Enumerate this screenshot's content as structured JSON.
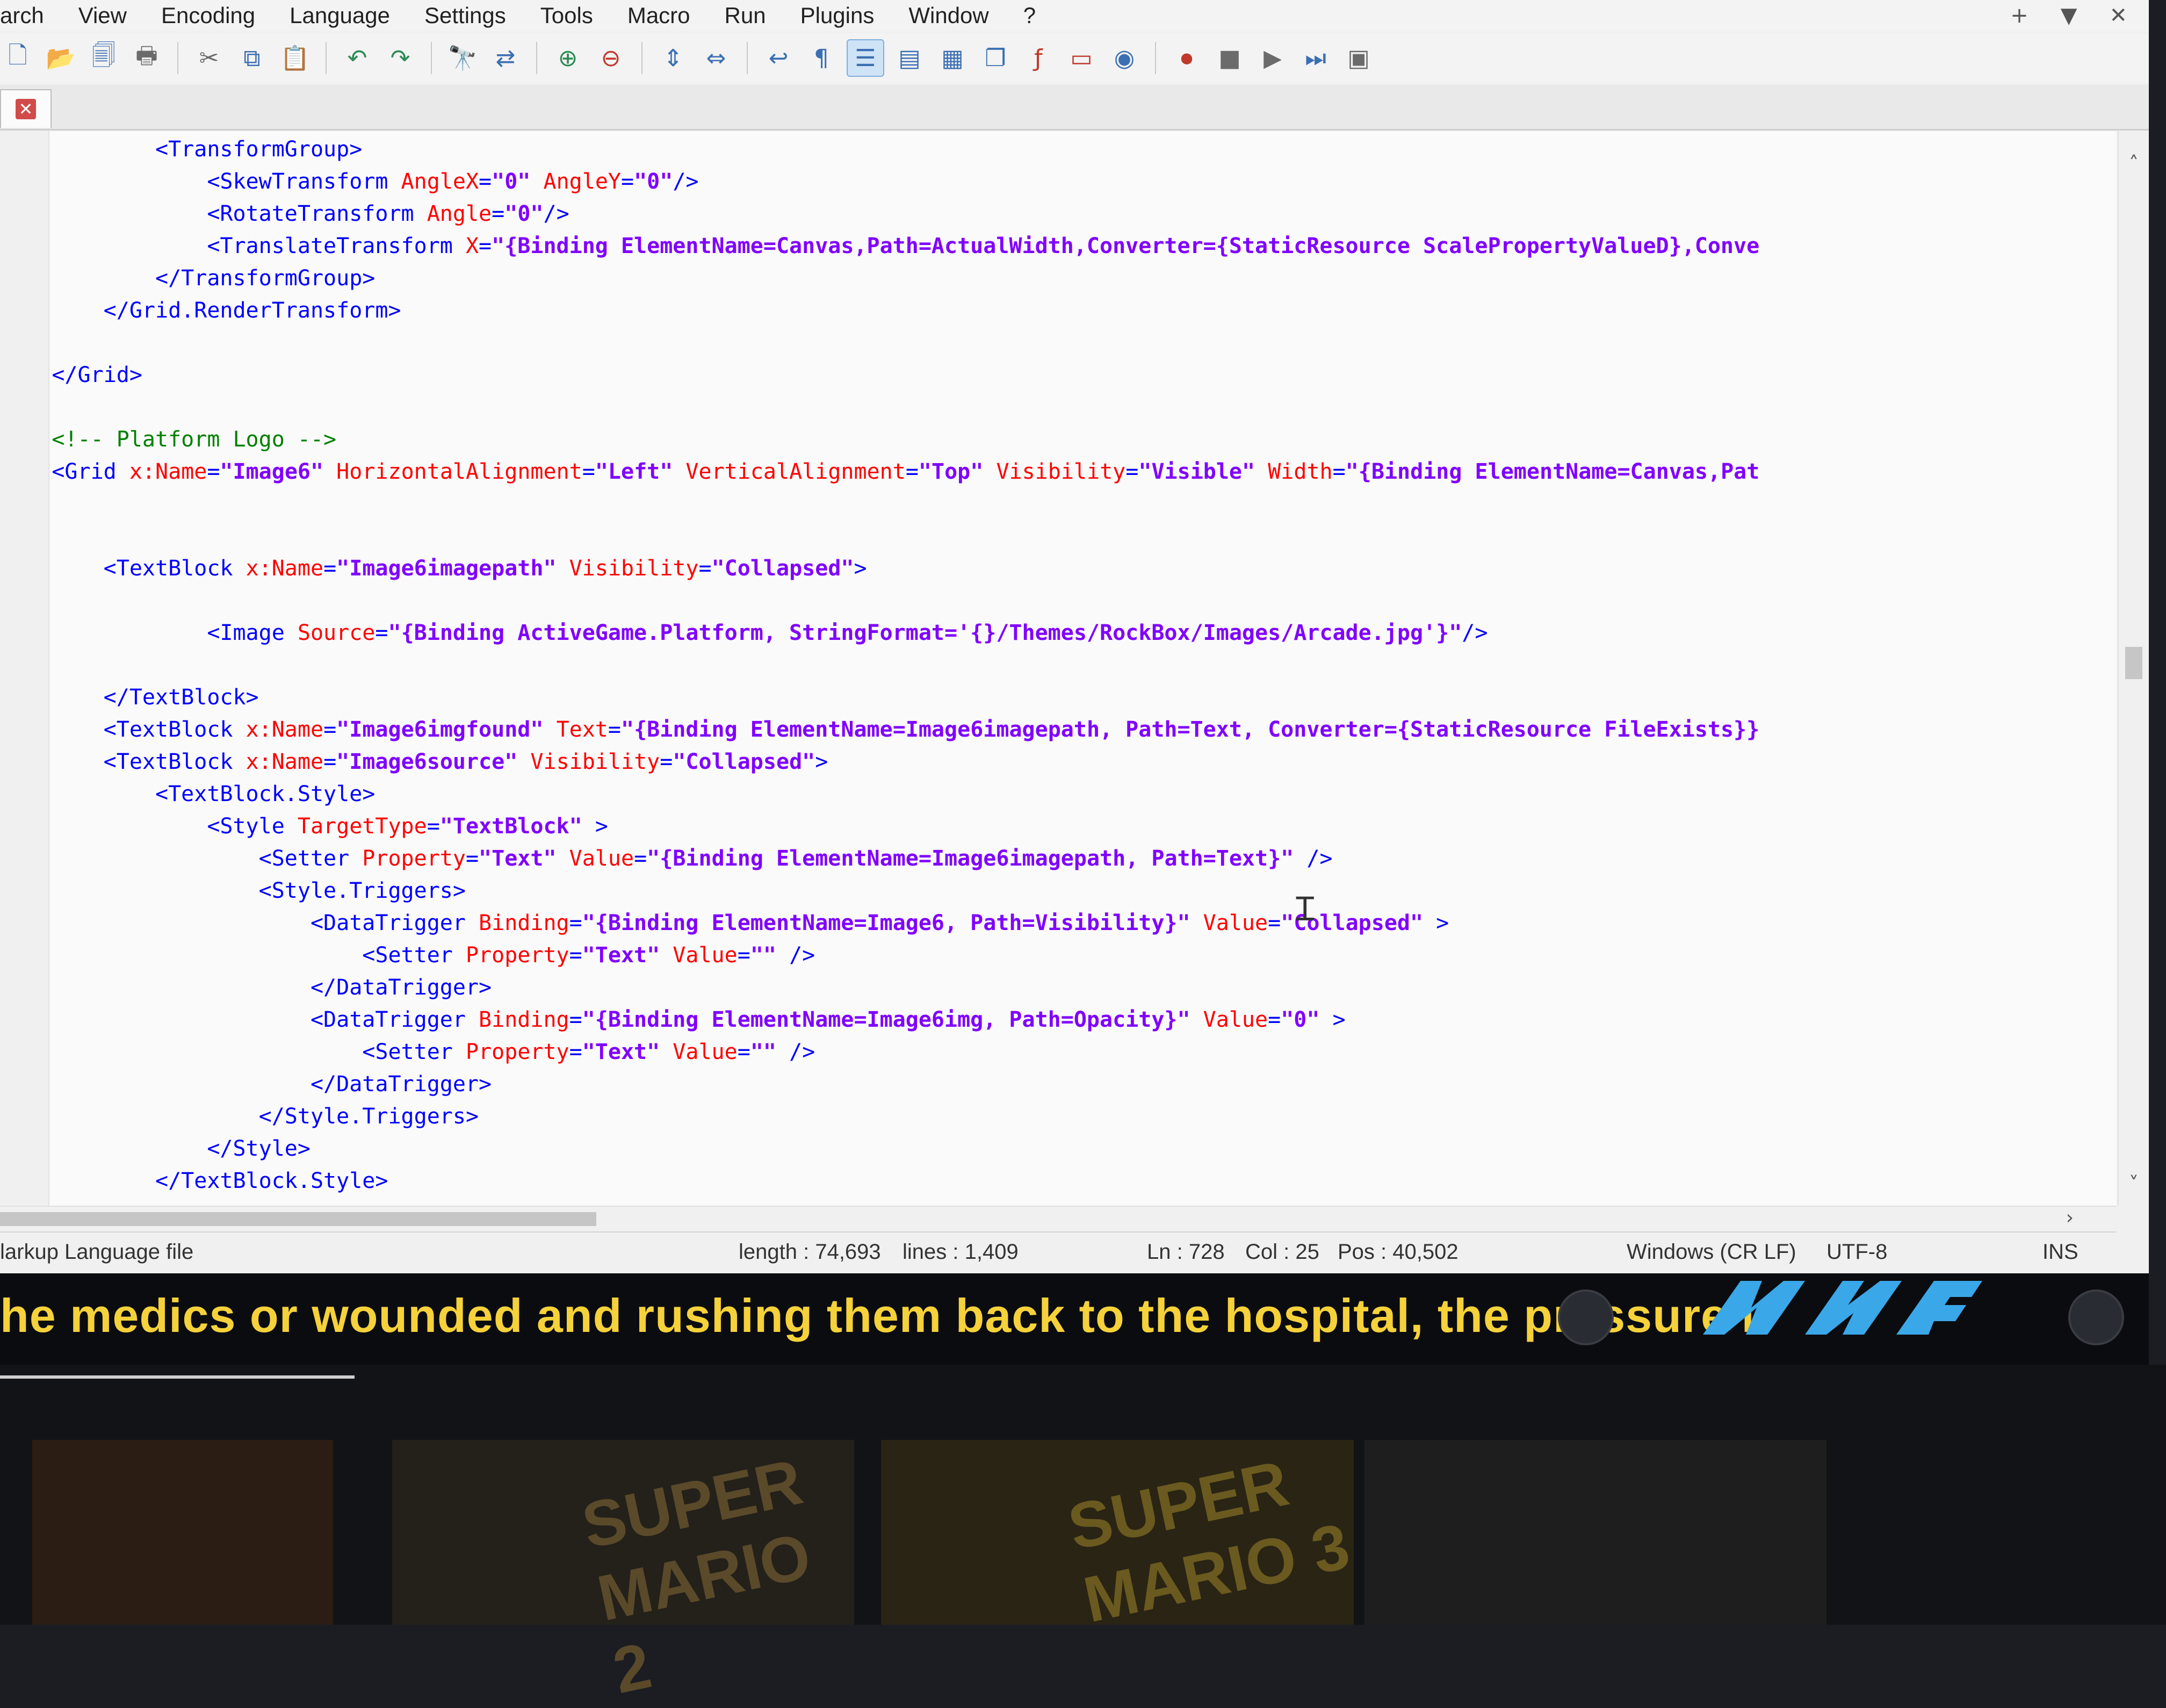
{
  "menu": [
    "arch",
    "View",
    "Encoding",
    "Language",
    "Settings",
    "Tools",
    "Macro",
    "Run",
    "Plugins",
    "Window",
    "?"
  ],
  "window_controls": {
    "add": "+",
    "dropdown": "▼",
    "close": "✕"
  },
  "toolbar": {
    "icons": [
      "new-file-icon",
      "open-file-icon",
      "save-all-icon",
      "print-icon",
      "cut-icon",
      "copy-icon",
      "paste-icon",
      "undo-icon",
      "redo-icon",
      "find-icon",
      "replace-icon",
      "zoom-in-icon",
      "zoom-out-icon",
      "sync-v-icon",
      "sync-h-icon",
      "word-wrap-icon",
      "show-all-chars-icon",
      "indent-guide-icon",
      "doc-map-icon",
      "function-list-icon",
      "folder-workspace-icon",
      "monitoring-icon",
      "record-macro-icon",
      "stop-record-icon",
      "play-macro-icon",
      "run-macro-multiple-icon",
      "save-macro-icon"
    ]
  },
  "tab": {
    "close": "✕"
  },
  "code_lines": [
    [
      {
        "k": "t",
        "s": "            <TransformGroup>"
      }
    ],
    [
      {
        "k": "t",
        "s": "                <SkewTransform "
      },
      {
        "k": "a",
        "s": "AngleX"
      },
      {
        "k": "t",
        "s": "="
      },
      {
        "k": "v",
        "s": "\"0\""
      },
      {
        "k": "t",
        "s": " "
      },
      {
        "k": "a",
        "s": "AngleY"
      },
      {
        "k": "t",
        "s": "="
      },
      {
        "k": "v",
        "s": "\"0\""
      },
      {
        "k": "t",
        "s": "/>"
      }
    ],
    [
      {
        "k": "t",
        "s": "                <RotateTransform "
      },
      {
        "k": "a",
        "s": "Angle"
      },
      {
        "k": "t",
        "s": "="
      },
      {
        "k": "v",
        "s": "\"0\""
      },
      {
        "k": "t",
        "s": "/>"
      }
    ],
    [
      {
        "k": "t",
        "s": "                <TranslateTransform "
      },
      {
        "k": "a",
        "s": "X"
      },
      {
        "k": "t",
        "s": "="
      },
      {
        "k": "v",
        "s": "\"{Binding ElementName=Canvas,Path=ActualWidth,Converter={StaticResource ScalePropertyValueD},Conve"
      }
    ],
    [
      {
        "k": "t",
        "s": "            </TransformGroup>"
      }
    ],
    [
      {
        "k": "t",
        "s": "        </Grid.RenderTransform>"
      }
    ],
    [
      {
        "k": "t",
        "s": ""
      }
    ],
    [
      {
        "k": "t",
        "s": "    </Grid>"
      }
    ],
    [
      {
        "k": "t",
        "s": ""
      }
    ],
    [
      {
        "k": "c",
        "s": "    <!-- Platform Logo -->"
      }
    ],
    [
      {
        "k": "t",
        "s": "    <Grid "
      },
      {
        "k": "a",
        "s": "x:Name"
      },
      {
        "k": "t",
        "s": "="
      },
      {
        "k": "v",
        "s": "\"Image6\""
      },
      {
        "k": "t",
        "s": " "
      },
      {
        "k": "a",
        "s": "HorizontalAlignment"
      },
      {
        "k": "t",
        "s": "="
      },
      {
        "k": "v",
        "s": "\"Left\""
      },
      {
        "k": "t",
        "s": " "
      },
      {
        "k": "a",
        "s": "VerticalAlignment"
      },
      {
        "k": "t",
        "s": "="
      },
      {
        "k": "v",
        "s": "\"Top\""
      },
      {
        "k": "t",
        "s": " "
      },
      {
        "k": "a",
        "s": "Visibility"
      },
      {
        "k": "t",
        "s": "="
      },
      {
        "k": "v",
        "s": "\"Visible\""
      },
      {
        "k": "t",
        "s": " "
      },
      {
        "k": "a",
        "s": "Width"
      },
      {
        "k": "t",
        "s": "="
      },
      {
        "k": "v",
        "s": "\"{Binding ElementName=Canvas,Pat"
      }
    ],
    [
      {
        "k": "t",
        "s": ""
      }
    ],
    [
      {
        "k": "t",
        "s": ""
      }
    ],
    [
      {
        "k": "t",
        "s": "        <TextBlock "
      },
      {
        "k": "a",
        "s": "x:Name"
      },
      {
        "k": "t",
        "s": "="
      },
      {
        "k": "v",
        "s": "\"Image6imagepath\""
      },
      {
        "k": "t",
        "s": " "
      },
      {
        "k": "a",
        "s": "Visibility"
      },
      {
        "k": "t",
        "s": "="
      },
      {
        "k": "v",
        "s": "\"Collapsed\""
      },
      {
        "k": "t",
        "s": ">"
      }
    ],
    [
      {
        "k": "t",
        "s": ""
      }
    ],
    [
      {
        "k": "t",
        "s": "                <Image "
      },
      {
        "k": "a",
        "s": "Source"
      },
      {
        "k": "t",
        "s": "="
      },
      {
        "k": "v",
        "s": "\"{Binding ActiveGame.Platform, StringFormat='{}/Themes/RockBox/Images/Arcade.jpg'}\""
      },
      {
        "k": "t",
        "s": "/>"
      }
    ],
    [
      {
        "k": "t",
        "s": ""
      }
    ],
    [
      {
        "k": "t",
        "s": "        </TextBlock>"
      }
    ],
    [
      {
        "k": "t",
        "s": "        <TextBlock "
      },
      {
        "k": "a",
        "s": "x:Name"
      },
      {
        "k": "t",
        "s": "="
      },
      {
        "k": "v",
        "s": "\"Image6imgfound\""
      },
      {
        "k": "t",
        "s": " "
      },
      {
        "k": "a",
        "s": "Text"
      },
      {
        "k": "t",
        "s": "="
      },
      {
        "k": "v",
        "s": "\"{Binding ElementName=Image6imagepath, Path=Text, Converter={StaticResource FileExists}}"
      }
    ],
    [
      {
        "k": "t",
        "s": "        <TextBlock "
      },
      {
        "k": "a",
        "s": "x:Name"
      },
      {
        "k": "t",
        "s": "="
      },
      {
        "k": "v",
        "s": "\"Image6source\""
      },
      {
        "k": "t",
        "s": " "
      },
      {
        "k": "a",
        "s": "Visibility"
      },
      {
        "k": "t",
        "s": "="
      },
      {
        "k": "v",
        "s": "\"Collapsed\""
      },
      {
        "k": "t",
        "s": ">"
      }
    ],
    [
      {
        "k": "t",
        "s": "            <TextBlock.Style>"
      }
    ],
    [
      {
        "k": "t",
        "s": "                <Style "
      },
      {
        "k": "a",
        "s": "TargetType"
      },
      {
        "k": "t",
        "s": "="
      },
      {
        "k": "v",
        "s": "\"TextBlock\""
      },
      {
        "k": "t",
        "s": " >"
      }
    ],
    [
      {
        "k": "t",
        "s": "                    <Setter "
      },
      {
        "k": "a",
        "s": "Property"
      },
      {
        "k": "t",
        "s": "="
      },
      {
        "k": "v",
        "s": "\"Text\""
      },
      {
        "k": "t",
        "s": " "
      },
      {
        "k": "a",
        "s": "Value"
      },
      {
        "k": "t",
        "s": "="
      },
      {
        "k": "v",
        "s": "\"{Binding ElementName=Image6imagepath, Path=Text}\""
      },
      {
        "k": "t",
        "s": " />"
      }
    ],
    [
      {
        "k": "t",
        "s": "                    <Style.Triggers>"
      }
    ],
    [
      {
        "k": "t",
        "s": "                        <DataTrigger "
      },
      {
        "k": "a",
        "s": "Binding"
      },
      {
        "k": "t",
        "s": "="
      },
      {
        "k": "v",
        "s": "\"{Binding ElementName=Image6, Path=Visibility}\""
      },
      {
        "k": "t",
        "s": " "
      },
      {
        "k": "a",
        "s": "Value"
      },
      {
        "k": "t",
        "s": "="
      },
      {
        "k": "v",
        "s": "\"Collapsed\""
      },
      {
        "k": "t",
        "s": " >"
      }
    ],
    [
      {
        "k": "t",
        "s": "                            <Setter "
      },
      {
        "k": "a",
        "s": "Property"
      },
      {
        "k": "t",
        "s": "="
      },
      {
        "k": "v",
        "s": "\"Text\""
      },
      {
        "k": "t",
        "s": " "
      },
      {
        "k": "a",
        "s": "Value"
      },
      {
        "k": "t",
        "s": "="
      },
      {
        "k": "v",
        "s": "\"\""
      },
      {
        "k": "t",
        "s": " />"
      }
    ],
    [
      {
        "k": "t",
        "s": "                        </DataTrigger>"
      }
    ],
    [
      {
        "k": "t",
        "s": "                        <DataTrigger "
      },
      {
        "k": "a",
        "s": "Binding"
      },
      {
        "k": "t",
        "s": "="
      },
      {
        "k": "v",
        "s": "\"{Binding ElementName=Image6img, Path=Opacity}\""
      },
      {
        "k": "t",
        "s": " "
      },
      {
        "k": "a",
        "s": "Value"
      },
      {
        "k": "t",
        "s": "="
      },
      {
        "k": "v",
        "s": "\"0\""
      },
      {
        "k": "t",
        "s": " >"
      }
    ],
    [
      {
        "k": "t",
        "s": "                            <Setter "
      },
      {
        "k": "a",
        "s": "Property"
      },
      {
        "k": "t",
        "s": "="
      },
      {
        "k": "v",
        "s": "\"Text\""
      },
      {
        "k": "t",
        "s": " "
      },
      {
        "k": "a",
        "s": "Value"
      },
      {
        "k": "t",
        "s": "="
      },
      {
        "k": "v",
        "s": "\"\""
      },
      {
        "k": "t",
        "s": " />"
      }
    ],
    [
      {
        "k": "t",
        "s": "                        </DataTrigger>"
      }
    ],
    [
      {
        "k": "t",
        "s": "                    </Style.Triggers>"
      }
    ],
    [
      {
        "k": "t",
        "s": "                </Style>"
      }
    ],
    [
      {
        "k": "t",
        "s": "            </TextBlock.Style>"
      }
    ]
  ],
  "status": {
    "filetype": "larkup Language file",
    "length": "length : 74,693",
    "lines": "lines : 1,409",
    "ln": "Ln : 728",
    "col": "Col : 25",
    "pos": "Pos : 40,502",
    "eol": "Windows (CR LF)",
    "encoding": "UTF-8",
    "mode": "INS"
  },
  "ticker": {
    "text": "he medics or wounded and rushing them back to the hospital, the pressure i",
    "logo_text": "nyw"
  },
  "shelf": {
    "covers": [
      "SUPER MARIO 2",
      "SUPER MARIO 3"
    ]
  },
  "colors": {
    "tag": "#0000ff",
    "attr": "#ff0000",
    "value": "#8000ff",
    "comment": "#008000",
    "ticker_text": "#f5d13a",
    "logo": "#3aa7e8"
  }
}
